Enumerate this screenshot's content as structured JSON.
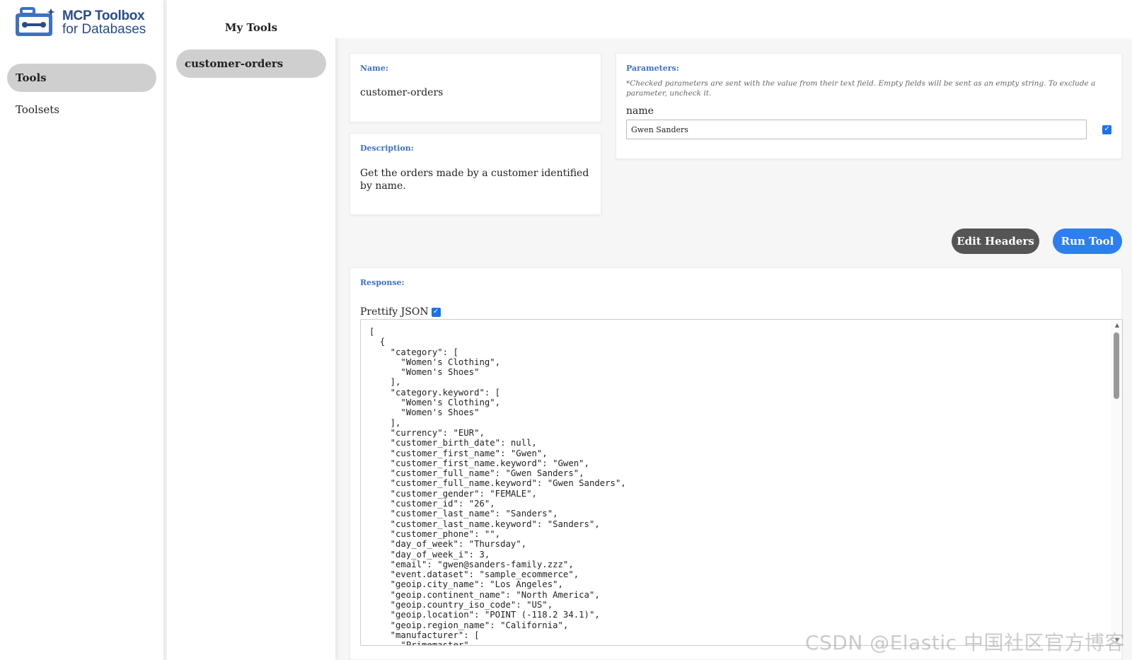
{
  "app": {
    "logo_line1": "MCP Toolbox",
    "logo_line2": "for Databases",
    "brand_color": "#2a4c89",
    "accent_color": "#2d7ff0"
  },
  "sidebar": {
    "items": [
      {
        "label": "Tools",
        "selected": true
      },
      {
        "label": "Toolsets",
        "selected": false
      }
    ]
  },
  "tools_panel": {
    "title": "My Tools",
    "items": [
      {
        "label": "customer-orders",
        "selected": true
      }
    ]
  },
  "tool": {
    "name_label": "Name:",
    "name": "customer-orders",
    "description_label": "Description:",
    "description": "Get the orders made by a customer identified by name."
  },
  "parameters": {
    "label": "Parameters:",
    "note": "*Checked parameters are sent with the value from their text field. Empty fields will be sent as an empty string. To exclude a parameter, uncheck it.",
    "items": [
      {
        "name": "name",
        "value": "Gwen Sanders",
        "checked": true
      }
    ]
  },
  "actions": {
    "edit_headers": "Edit Headers",
    "run_tool": "Run Tool"
  },
  "response": {
    "label": "Response:",
    "prettify_label": "Prettify JSON",
    "prettify_checked": true,
    "json_lines": [
      "[",
      "  {",
      "    \"category\": [",
      "      \"Women's Clothing\",",
      "      \"Women's Shoes\"",
      "    ],",
      "    \"category.keyword\": [",
      "      \"Women's Clothing\",",
      "      \"Women's Shoes\"",
      "    ],",
      "    \"currency\": \"EUR\",",
      "    \"customer_birth_date\": null,",
      "    \"customer_first_name\": \"Gwen\",",
      "    \"customer_first_name.keyword\": \"Gwen\",",
      "    \"customer_full_name\": \"Gwen Sanders\",",
      "    \"customer_full_name.keyword\": \"Gwen Sanders\",",
      "    \"customer_gender\": \"FEMALE\",",
      "    \"customer_id\": \"26\",",
      "    \"customer_last_name\": \"Sanders\",",
      "    \"customer_last_name.keyword\": \"Sanders\",",
      "    \"customer_phone\": \"\",",
      "    \"day_of_week\": \"Thursday\",",
      "    \"day_of_week_i\": 3,",
      "    \"email\": \"gwen@sanders-family.zzz\",",
      "    \"event.dataset\": \"sample_ecommerce\",",
      "    \"geoip.city_name\": \"Los Angeles\",",
      "    \"geoip.continent_name\": \"North America\",",
      "    \"geoip.country_iso_code\": \"US\",",
      "    \"geoip.location\": \"POINT (-118.2 34.1)\",",
      "    \"geoip.region_name\": \"California\",",
      "    \"manufacturer\": [",
      "      \"Primemaster\","
    ]
  },
  "watermark": "CSDN @Elastic 中国社区官方博客"
}
